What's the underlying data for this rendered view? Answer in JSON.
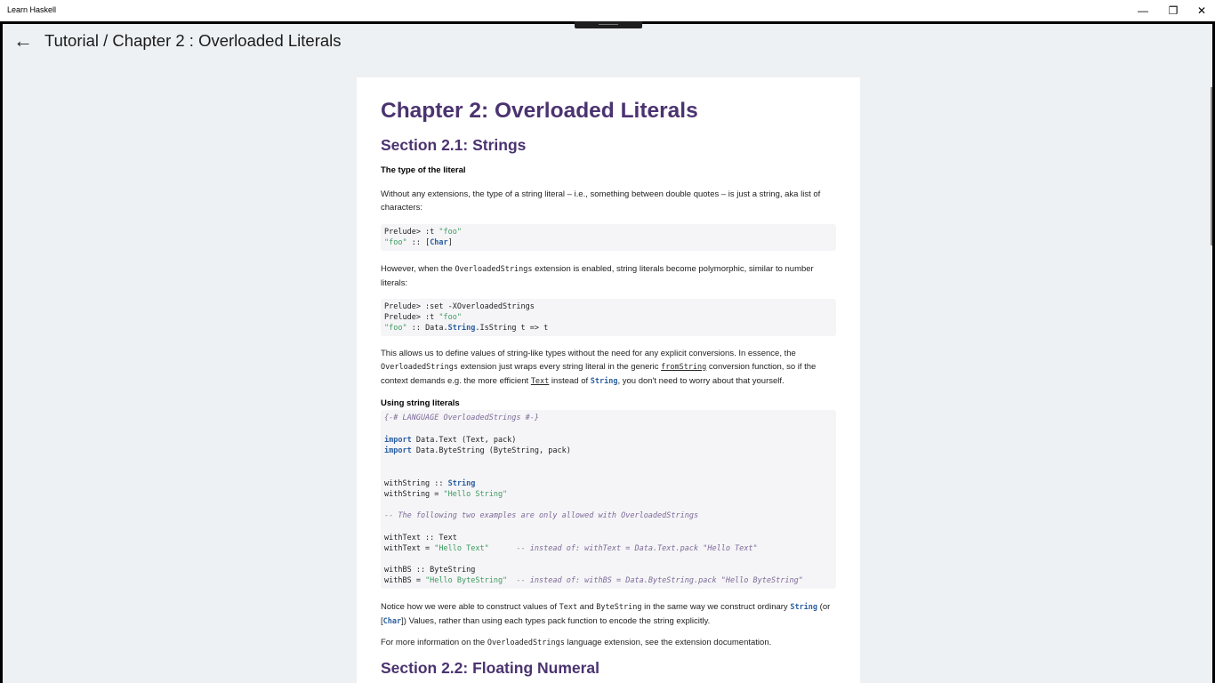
{
  "window": {
    "title": "Learn Haskell",
    "minimize": "—",
    "restore": "❐",
    "close": "✕"
  },
  "header": {
    "back_icon": "←",
    "title": "Tutorial / Chapter 2 :  Overloaded Literals"
  },
  "doc": {
    "h1": "Chapter 2: Overloaded Literals",
    "section1": "Section 2.1: Strings",
    "sub1": "The type of the literal",
    "p1": "Without any extensions, the type of a string literal – i.e., something between double quotes – is just a string, aka list of characters:",
    "code1": {
      "l1a": "Prelude> :t ",
      "l1b": "\"foo\"",
      "l2a": "\"foo\"",
      "l2b": " :: [",
      "l2c": "Char",
      "l2d": "]"
    },
    "p2a": "However, when the ",
    "p2b": "OverloadedStrings",
    "p2c": " extension is enabled, string literals become polymorphic, similar to number literals:",
    "code2": {
      "l1": "Prelude> :set -XOverloadedStrings",
      "l2a": "Prelude> :t ",
      "l2b": "\"foo\"",
      "l3a": "\"foo\"",
      "l3b": " :: Data.",
      "l3c": "String",
      "l3d": ".IsString t => t"
    },
    "p3a": "This allows us to define values of string-like types without the need for any explicit conversions. In essence, the ",
    "p3b": "OverloadedStrings",
    "p3c": " extension just wraps every string literal in the generic ",
    "p3d": "fromString",
    "p3e": " conversion function, so if the context demands e.g. the more efficient ",
    "p3f": "Text",
    "p3g": " instead of ",
    "p3h": "String",
    "p3i": ", you don't need to worry about that yourself.",
    "sub2": "Using string literals",
    "code3": {
      "pragma": "{-# LANGUAGE OverloadedStrings #-}",
      "import_kw": "import",
      "import1": " Data.Text (Text, pack)",
      "import2": " Data.ByteString (ByteString, pack)",
      "ws1a": "withString :: ",
      "ws1b": "String",
      "ws2a": "withString = ",
      "ws2b": "\"Hello String\"",
      "comment1": "-- The following two examples are only allowed with OverloadedStrings",
      "wt1": "withText :: Text",
      "wt2a": "withText = ",
      "wt2b": "\"Hello Text\"",
      "wt2c": "      -- instead of: withText = Data.Text.pack \"Hello Text\"",
      "wb1": "withBS :: ByteString",
      "wb2a": "withBS = ",
      "wb2b": "\"Hello ByteString\"",
      "wb2c": "  -- instead of: withBS = Data.ByteString.pack \"Hello ByteString\""
    },
    "p4a": "Notice how we were able to construct values of ",
    "p4b": "Text",
    "p4c": " and ",
    "p4d": "ByteString",
    "p4e": " in the same way we construct ordinary ",
    "p4f": "String",
    "p4g": " (or [",
    "p4h": "Char",
    "p4i": "]) Values, rather than using each types ",
    "p4j": "pack",
    "p4k": " function to encode the string explicitly.",
    "p5a": "For more information on the ",
    "p5b": "OverloadedStrings",
    "p5c": " language extension, see the extension documentation.",
    "section2": "Section 2.2: Floating Numeral"
  }
}
